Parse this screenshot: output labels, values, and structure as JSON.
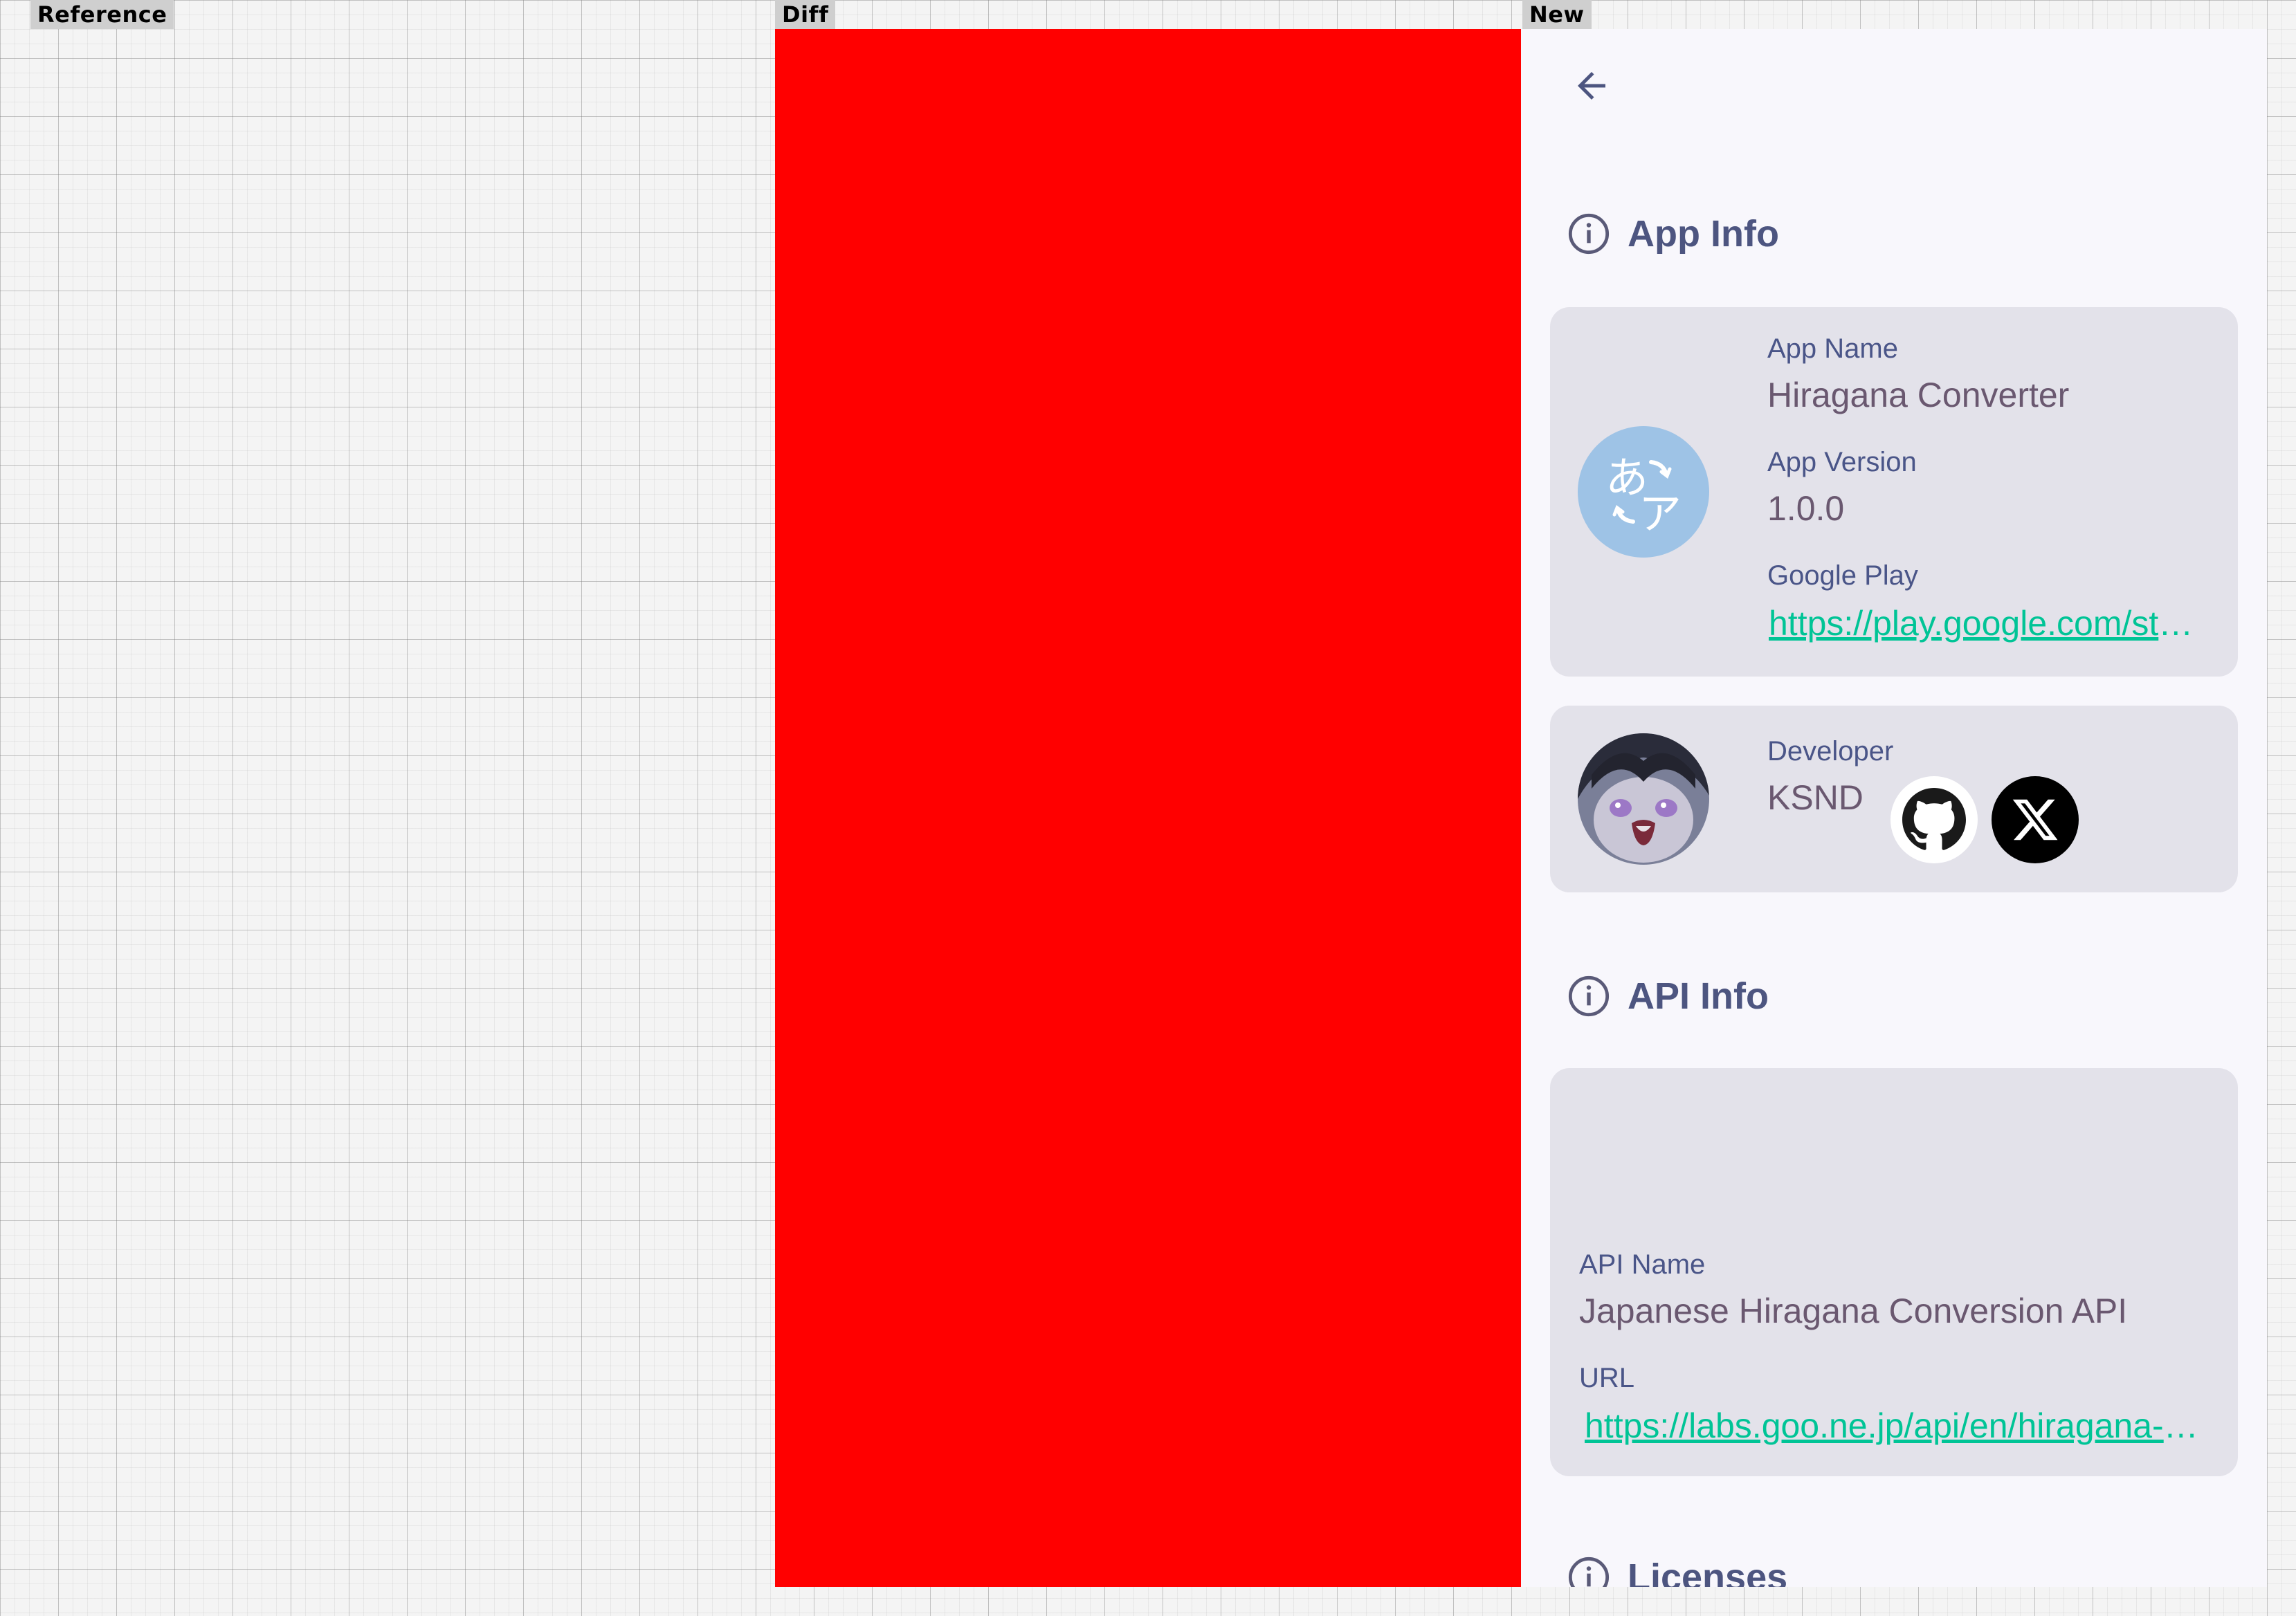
{
  "panels": {
    "reference_label": "Reference",
    "diff_label": "Diff",
    "new_label": "New"
  },
  "colors": {
    "diff_fill": "#ff0000",
    "accent_link": "#00c496",
    "section_title": "#4d5580",
    "card_bg": "#e3e2ea"
  },
  "icons": {
    "back": "arrow-back-icon",
    "section": "info-circle-icon",
    "github": "github-icon",
    "x": "x-logo-icon"
  },
  "app_info": {
    "section_title": "App Info",
    "app_name_label": "App Name",
    "app_name": "Hiragana Converter",
    "app_version_label": "App Version",
    "app_version": "1.0.0",
    "google_play_label": "Google Play",
    "google_play_link": "https://play.google.com/store/apps",
    "icon_glyph_top": "あ",
    "icon_glyph_bottom": "ア"
  },
  "developer": {
    "label": "Developer",
    "name": "KSND"
  },
  "api_info": {
    "section_title": "API Info",
    "api_name_label": "API Name",
    "api_name": "Japanese Hiragana Conversion API",
    "url_label": "URL",
    "url": "https://labs.goo.ne.jp/api/en/hiragana-translation/"
  },
  "licenses": {
    "section_title": "Licenses"
  }
}
